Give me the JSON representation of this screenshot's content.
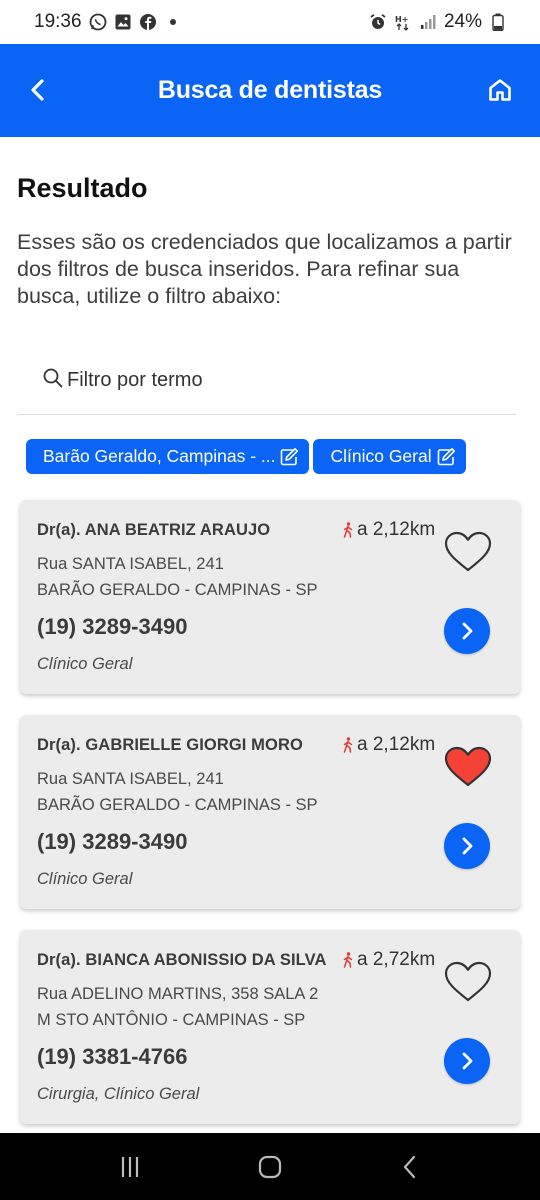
{
  "status_bar": {
    "time": "19:36",
    "battery": "24%"
  },
  "app_bar": {
    "title": "Busca de dentistas"
  },
  "results": {
    "heading": "Resultado",
    "description": "Esses são os credenciados que localizamos a partir dos filtros de busca inseridos. Para refinar sua busca, utilize o filtro abaixo:"
  },
  "filter": {
    "placeholder": "Filtro por termo",
    "value": ""
  },
  "chips": [
    {
      "label": "Barão Geraldo, Campinas - ..."
    },
    {
      "label": "Clínico Geral"
    }
  ],
  "dentists": [
    {
      "name": "Dr(a). ANA BEATRIZ ARAUJO",
      "distance": "a 2,12km",
      "address_line1": "Rua SANTA ISABEL, 241",
      "address_line2": "BARÃO GERALDO - CAMPINAS - SP",
      "phone": "(19) 3289-3490",
      "specialty": "Clínico Geral",
      "favorite": false
    },
    {
      "name": "Dr(a). GABRIELLE GIORGI MORO",
      "distance": "a 2,12km",
      "address_line1": "Rua SANTA ISABEL, 241",
      "address_line2": "BARÃO GERALDO - CAMPINAS - SP",
      "phone": "(19) 3289-3490",
      "specialty": "Clínico Geral",
      "favorite": true
    },
    {
      "name": "Dr(a). BIANCA ABONISSIO DA SILVA",
      "distance": "a 2,72km",
      "address_line1": "Rua ADELINO MARTINS, 358 SALA 2",
      "address_line2": "M STO ANTÔNIO - CAMPINAS - SP",
      "phone": "(19) 3381-4766",
      "specialty": "Cirurgia, Clínico Geral",
      "favorite": false
    }
  ],
  "colors": {
    "primary": "#0a64f5",
    "favorite_active": "#f44336",
    "walk_icon": "#e53935",
    "card_bg": "#ececec"
  },
  "icons": {
    "back": "chevron-left-icon",
    "home": "home-icon",
    "search": "search-icon",
    "edit": "edit-icon",
    "walk": "walking-person-icon",
    "favorite": "heart-icon",
    "go": "chevron-right-icon"
  }
}
